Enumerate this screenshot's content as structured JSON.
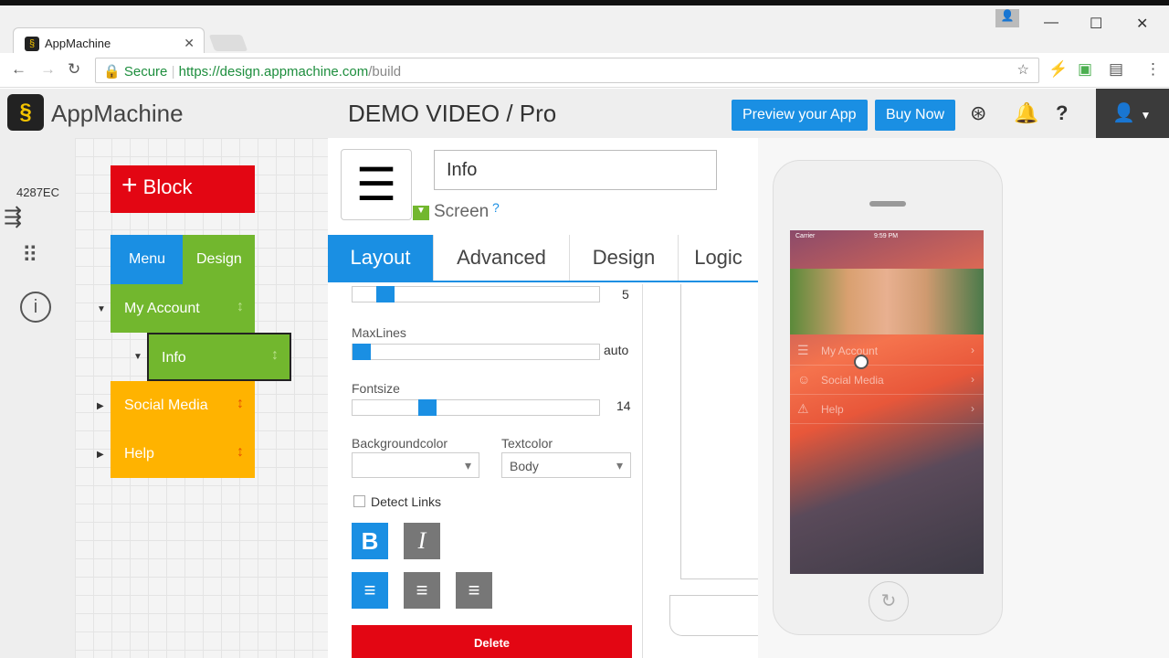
{
  "browser": {
    "tab_title": "AppMachine",
    "secure_label": "Secure",
    "url_host": "https://design.appmachine.com",
    "url_path": "/build"
  },
  "header": {
    "app_name": "AppMachine",
    "project": "DEMO VIDEO / Pro",
    "preview_label": "Preview your App",
    "buy_label": "Buy Now"
  },
  "leftnav": {
    "app_id": "4287EC"
  },
  "blocks": {
    "add_label": "Block",
    "menu": "Menu",
    "design": "Design",
    "items": [
      {
        "label": "My Account",
        "color": "#72b72e"
      },
      {
        "label": "Info",
        "color": "#72b72e"
      },
      {
        "label": "Social Media",
        "color": "#ffb300"
      },
      {
        "label": "Help",
        "color": "#ffb300"
      }
    ]
  },
  "panel": {
    "title_value": "Info",
    "type_label": "Screen",
    "help": "?",
    "tabs": [
      "Layout",
      "Advanced",
      "Design",
      "Logic"
    ],
    "slider1_value": "5",
    "maxlines_label": "MaxLines",
    "maxlines_value": "auto",
    "fontsize_label": "Fontsize",
    "fontsize_value": "14",
    "bg_label": "Backgroundcolor",
    "bg_value": "",
    "text_label": "Textcolor",
    "text_value": "Body",
    "detect_links": "Detect Links",
    "bold": "B",
    "italic": "I",
    "delete_label": "Delete"
  },
  "phone": {
    "carrier": "Carrier",
    "time": "9:59 PM",
    "menu": [
      "My Account",
      "Social Media",
      "Help"
    ]
  },
  "colors": {
    "accent": "#1a8fe3",
    "red": "#e30613",
    "green": "#72b72e",
    "orange": "#ffb300"
  }
}
